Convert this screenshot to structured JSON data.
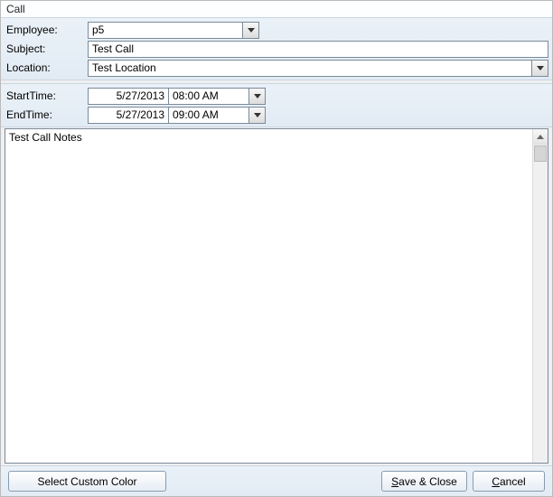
{
  "window": {
    "title": "Call"
  },
  "labels": {
    "employee": "Employee:",
    "subject": "Subject:",
    "location": "Location:",
    "start": "StartTime:",
    "end": "EndTime:"
  },
  "values": {
    "employee": "p5",
    "subject": "Test Call",
    "location": "Test Location",
    "start_date": "5/27/2013",
    "start_time": "08:00 AM",
    "end_date": "5/27/2013",
    "end_time": "09:00 AM",
    "notes": "Test Call Notes"
  },
  "buttons": {
    "color": "Select Custom Color",
    "save": "Save & Close",
    "cancel": "Cancel"
  }
}
